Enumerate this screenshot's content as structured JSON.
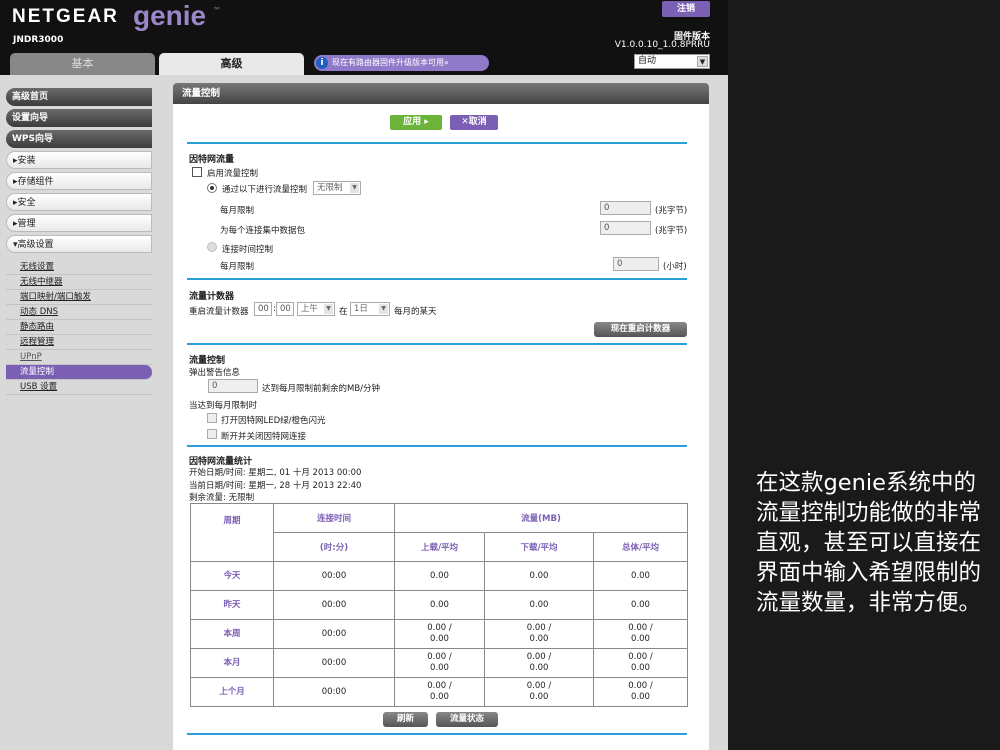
{
  "header": {
    "brand": "NETGEAR",
    "product": "genie",
    "trademark": "™",
    "model": "JNDR3000",
    "logout_label": "注销",
    "firmware_label": "固件版本",
    "firmware_version": "V1.0.0.10_1.0.8PRRU",
    "language_select": "自动"
  },
  "tabs": [
    {
      "label": "基本"
    },
    {
      "label": "高级"
    }
  ],
  "firmware_notice": "现在有路由器固件升级版本可用»",
  "sidebar": {
    "main_items": [
      "高级首页",
      "设置向导",
      "WPS向导"
    ],
    "group_items": [
      "▸安装",
      "▸存储组件",
      "▸安全",
      "▸管理",
      "▾高级设置"
    ],
    "sub_items": [
      "无线设置",
      "无线中继器",
      "端口映射/端口触发",
      "动态 DNS",
      "静态路由",
      "远程管理",
      "UPnP",
      "流量控制",
      "USB 设置"
    ]
  },
  "main": {
    "title": "流量控制",
    "apply_label": "应用 ▸",
    "cancel_label": "✕取消",
    "internet_traffic": {
      "title": "因特网流量",
      "enable_label": "启用流量控制",
      "by_volume_label": "通过以下进行流量控制",
      "volume_mode": "无限制",
      "monthly_limit_label": "每月限制",
      "monthly_limit_value": "0",
      "unit_mb": "(兆字节)",
      "per_connection_label": "为每个连接集中数据包",
      "per_connection_value": "0",
      "by_time_label": "连接时间控制",
      "time_limit_label": "每月限制",
      "time_limit_value": "0",
      "unit_hours": "(小时)"
    },
    "counter": {
      "title": "流量计数器",
      "restart_label": "重启流量计数器",
      "hour": "00",
      "minute": "00",
      "ampm": "上午",
      "at_label": "在",
      "day": "1日",
      "day_suffix": "每月的某天",
      "restart_now_label": "现在重启计数器"
    },
    "control": {
      "title": "流量控制",
      "popup_label": "弹出警告信息",
      "popup_value": "0",
      "popup_suffix": "达到每月限制前剩余的MB/分钟",
      "limit_reached_label": "当达到每月限制时",
      "led_label": "打开因特网LED绿/橙色闪光",
      "disconnect_label": "断开并关闭因特网连接"
    },
    "statistics": {
      "title": "因特网流量统计",
      "start_label": "开始日期/时间: 星期二, 01 十月 2013 00:00",
      "current_label": "当前日期/时间: 星期一, 28 十月 2013 22:40",
      "remaining_label": "剩余流量: 无限制",
      "headers": {
        "period": "周期",
        "connect_time": "连接时间",
        "traffic": "流量(MB)",
        "time_unit": "(时:分)",
        "upload": "上载/平均",
        "download": "下载/平均",
        "total": "总体/平均"
      },
      "rows": [
        {
          "period": "今天",
          "time": "00:00",
          "up": "0.00",
          "down": "0.00",
          "total": "0.00"
        },
        {
          "period": "昨天",
          "time": "00:00",
          "up": "0.00",
          "down": "0.00",
          "total": "0.00"
        },
        {
          "period": "本周",
          "time": "00:00",
          "up": "0.00 /\n0.00",
          "down": "0.00 /\n0.00",
          "total": "0.00 /\n0.00"
        },
        {
          "period": "本月",
          "time": "00:00",
          "up": "0.00 /\n0.00",
          "down": "0.00 /\n0.00",
          "total": "0.00 /\n0.00"
        },
        {
          "period": "上个月",
          "time": "00:00",
          "up": "0.00 /\n0.00",
          "down": "0.00 /\n0.00",
          "total": "0.00 /\n0.00"
        }
      ],
      "refresh_label": "刷新",
      "status_label": "流量状态"
    }
  },
  "caption": "在这款genie系统中的流量控制功能做的非常直观，甚至可以直接在界面中输入希望限制的流量数量，非常方便。"
}
